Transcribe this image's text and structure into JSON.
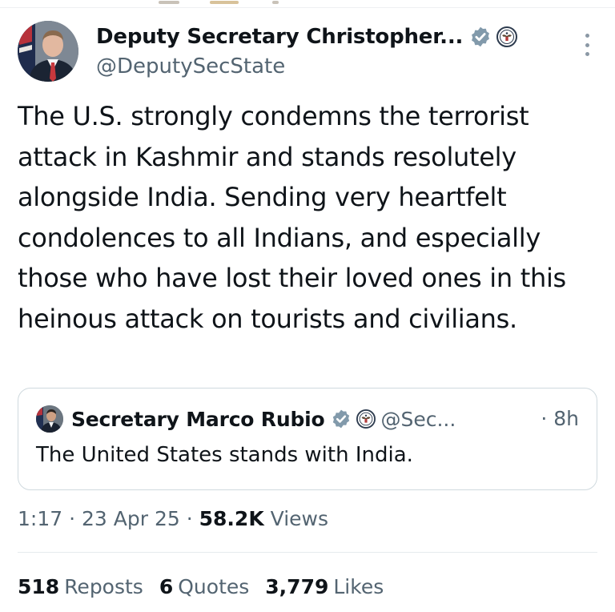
{
  "post": {
    "author": {
      "display_name": "Deputy Secretary Christopher...",
      "handle": "@DeputySecState",
      "verified_color": "#829aab"
    },
    "text": "The U.S. strongly condemns the terrorist attack in Kashmir and stands resolutely alongside India. Sending very heartfelt condolences to all Indians, and especially those who have lost their loved ones in this heinous attack on tourists and civilians.",
    "quoted": {
      "display_name": "Secretary Marco Rubio",
      "handle": "@Sec...",
      "time": "· 8h",
      "text": "The United States stands with India."
    },
    "meta": {
      "time": "1:17",
      "sep1": "·",
      "date": "23 Apr 25",
      "sep2": "·",
      "views_count": "58.2K",
      "views_label": "Views"
    },
    "stats": {
      "reposts_count": "518",
      "reposts_label": "Reposts",
      "quotes_count": "6",
      "quotes_label": "Quotes",
      "likes_count": "3,779",
      "likes_label": "Likes"
    }
  },
  "icons": {
    "verified": "verified-badge-icon",
    "seal": "state-department-seal-icon",
    "more": "more-options-icon"
  }
}
